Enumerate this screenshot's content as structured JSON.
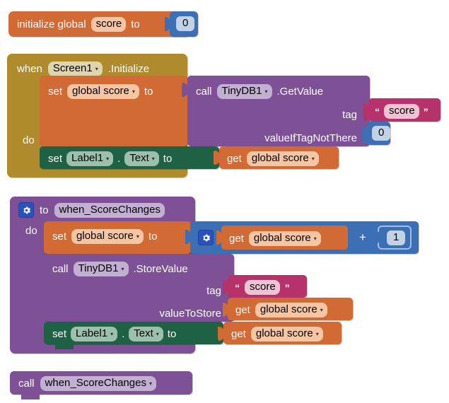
{
  "workspace": {
    "app": "MIT App Inventor Blocks Editor",
    "background_color": "#ffffff"
  },
  "palette": {
    "variable_orange": "#D26A36",
    "event_gold": "#B08B2E",
    "component_purple": "#7E5197",
    "control_purple": "#7E5197",
    "setter_green": "#1E6145",
    "math_blue": "#3C6FB4",
    "text_crimson": "#B5336A"
  },
  "blocks": {
    "init_global": {
      "keyword": "initialize global",
      "name": "score",
      "to": "to",
      "value": "0"
    },
    "when_screen1": {
      "when": "when",
      "component": "Screen1",
      "event": ".Initialize",
      "do": "do",
      "set_global": {
        "set": "set",
        "variable": "global score",
        "to": "to"
      },
      "call_getvalue": {
        "call": "call",
        "component": "TinyDB1",
        "method": ".GetValue",
        "args": [
          {
            "name": "tag",
            "value": "score",
            "type": "text"
          },
          {
            "name": "valueIfTagNotThere",
            "value": "0",
            "type": "number"
          }
        ]
      },
      "set_label": {
        "set": "set",
        "component": "Label1",
        "dot": ".",
        "property": "Text",
        "to": "to",
        "get": "get",
        "variable": "global score"
      }
    },
    "procedure": {
      "gear_icon": "gear-icon",
      "to": "to",
      "name": "when_ScoreChanges",
      "do": "do",
      "set_global": {
        "set": "set",
        "variable": "global score",
        "to": "to"
      },
      "addition": {
        "gear_icon": "gear-icon",
        "get": "get",
        "variable": "global score",
        "operator": "+",
        "operand": "1"
      },
      "call_storevalue": {
        "call": "call",
        "component": "TinyDB1",
        "method": ".StoreValue",
        "args": [
          {
            "name": "tag",
            "value": "score",
            "type": "text"
          },
          {
            "name": "valueToStore",
            "value": "global score",
            "type": "get"
          }
        ]
      },
      "set_label": {
        "set": "set",
        "component": "Label1",
        "dot": ".",
        "property": "Text",
        "to": "to",
        "get": "get",
        "variable": "global score"
      }
    },
    "call_procedure": {
      "call": "call",
      "name": "when_ScoreChanges"
    }
  },
  "icons": {
    "caret": "▾",
    "quote_open": "“",
    "quote_close": "”"
  }
}
